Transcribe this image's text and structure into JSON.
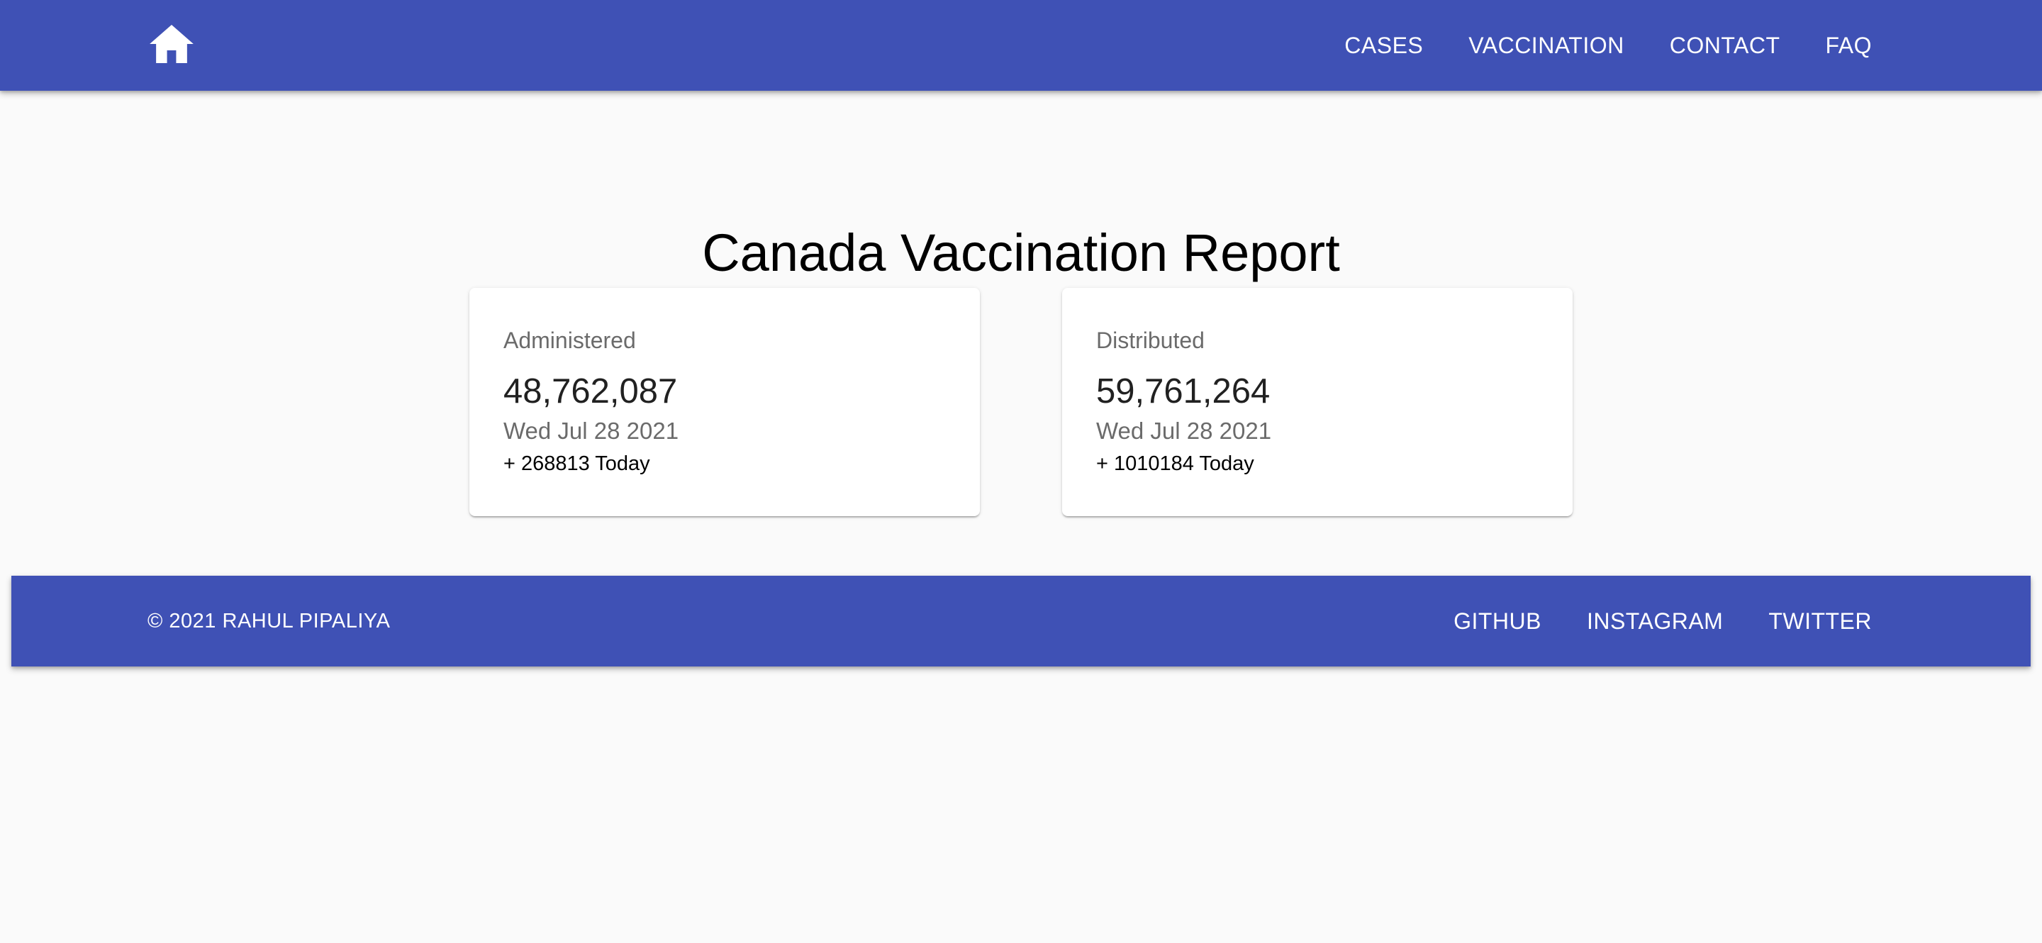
{
  "header": {
    "home_icon": "home-icon",
    "nav": [
      {
        "label": "CASES"
      },
      {
        "label": "VACCINATION"
      },
      {
        "label": "CONTACT"
      },
      {
        "label": "FAQ"
      }
    ]
  },
  "main": {
    "title": "Canada Vaccination Report",
    "cards": [
      {
        "label": "Administered",
        "value": "48,762,087",
        "date": "Wed Jul 28 2021",
        "today": "+ 268813 Today"
      },
      {
        "label": "Distributed",
        "value": "59,761,264",
        "date": "Wed Jul 28 2021",
        "today": "+ 1010184 Today"
      }
    ]
  },
  "footer": {
    "copyright": "© 2021 RAHUL PIPALIYA",
    "links": [
      {
        "label": "GITHUB"
      },
      {
        "label": "INSTAGRAM"
      },
      {
        "label": "TWITTER"
      }
    ]
  },
  "colors": {
    "primary": "#3f51b5",
    "background": "#fafafa",
    "card": "#ffffff",
    "muted_text": "#6b6b6b"
  }
}
